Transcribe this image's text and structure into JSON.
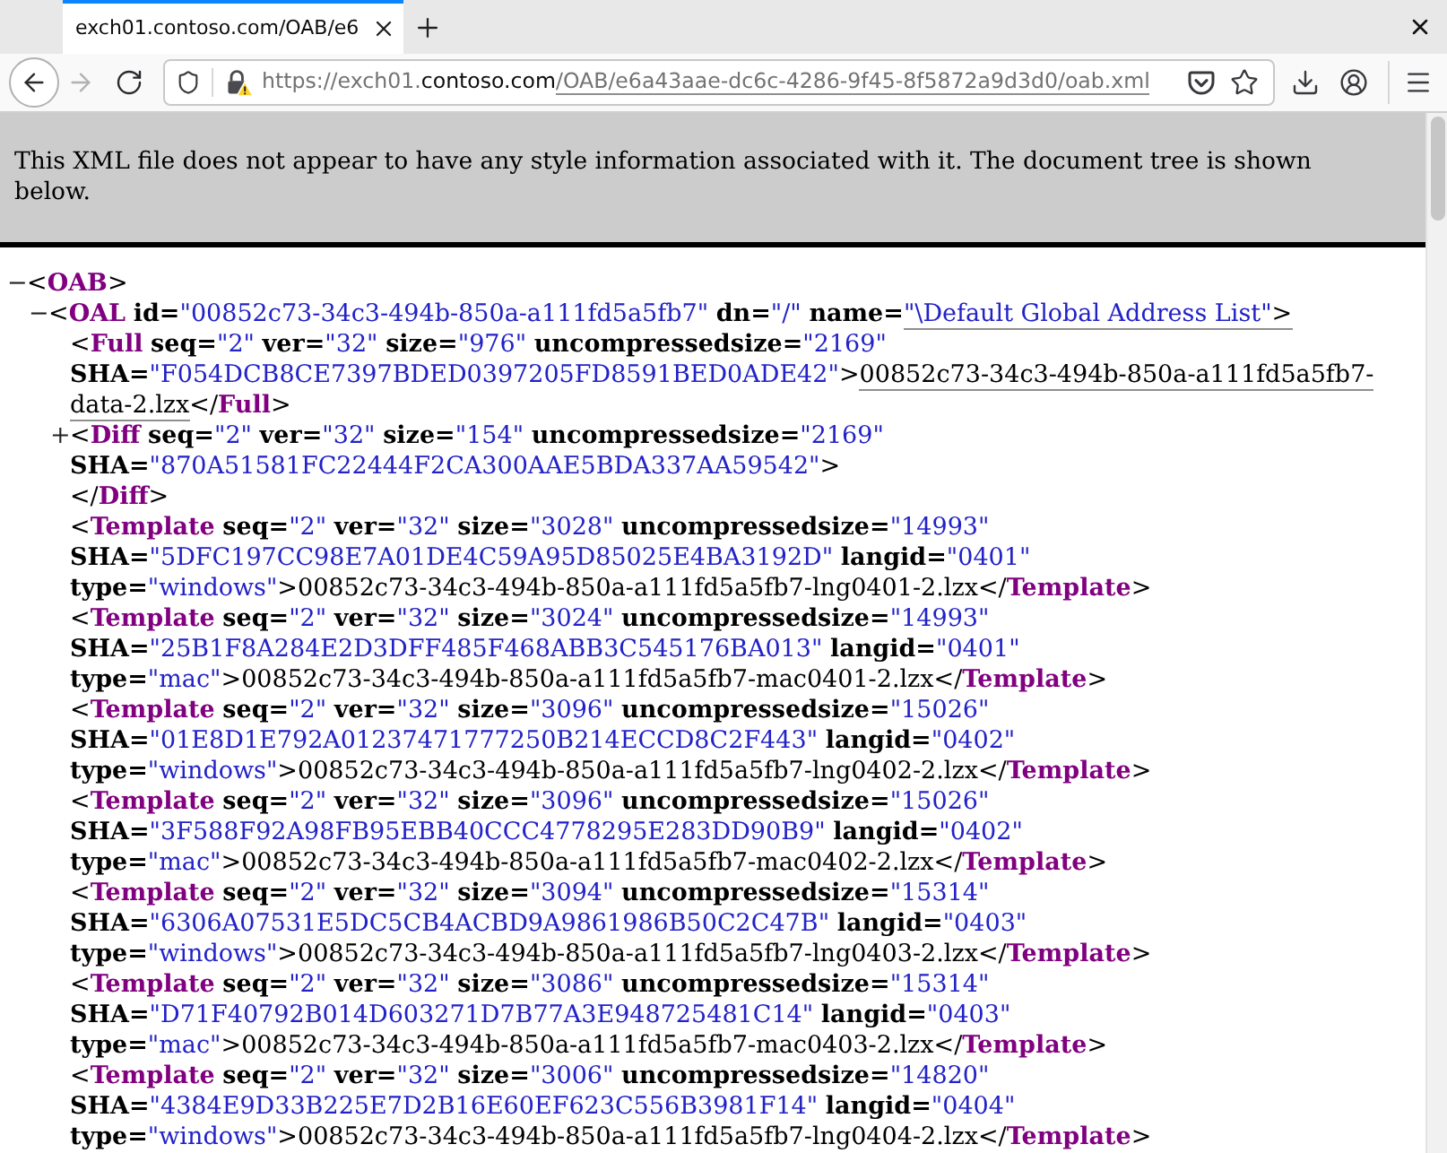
{
  "browser": {
    "tabs": [
      {
        "title": "exch01.contoso.com/OAB/e6",
        "selected": true
      }
    ],
    "nav_buttons": [
      {
        "kind": "back",
        "disabled": false
      },
      {
        "kind": "forward",
        "disabled": true
      },
      {
        "kind": "reload",
        "disabled": false
      }
    ],
    "address": {
      "scheme": "https://",
      "subdomain": "exch01.",
      "domain": "contoso.com",
      "path": "/OAB/e6a43aae-dc6c-4286-9f45-8f5872a9d3d0/oab.xml",
      "path_underlined": true
    }
  },
  "notice": "This XML file does not appear to have any style information associated with it. The document tree is shown below.",
  "xml_tree": [
    {
      "kind": "container",
      "toggle": "−",
      "open": "<",
      "tag": "OAB",
      "close": ">",
      "children": [
        {
          "kind": "container",
          "toggle": "−",
          "open": "<",
          "tag": "OAL",
          "attributes": [
            {
              "name": "id=",
              "value": "\"00852c73-34c3-494b-850a-a111fd5a5fb7\""
            },
            {
              "name": "dn=",
              "value": "\"/\""
            },
            {
              "name": "name=",
              "value": "\"\\Default Global Address List\"",
              "underlined": true
            }
          ],
          "close": ">",
          "children": [
            {
              "kind": "leaf",
              "open": "<",
              "tag": "Full",
              "attributes": [
                {
                  "name": "seq=",
                  "value": "\"2\""
                },
                {
                  "name": "ver=",
                  "value": "\"32\""
                },
                {
                  "name": "size=",
                  "value": "\"976\""
                },
                {
                  "name": "uncompressedsize=",
                  "value": "\"2169\""
                },
                {
                  "name": "SHA=",
                  "value": "\"F054DCB8CE7397BDED0397205FD8591BED0ADE42\""
                }
              ],
              "close": ">",
              "text": "00852c73-34c3-494b-850a-a111fd5a5fb7-data-2.lzx",
              "text_underlined": true,
              "end_open": "</",
              "end_tag": "Full",
              "end_close": ">"
            },
            {
              "kind": "container",
              "toggle": "+",
              "open": "<",
              "tag": "Diff",
              "attributes": [
                {
                  "name": "seq=",
                  "value": "\"2\""
                },
                {
                  "name": "ver=",
                  "value": "\"32\""
                },
                {
                  "name": "size=",
                  "value": "\"154\""
                },
                {
                  "name": "uncompressedsize=",
                  "value": "\"2169\""
                },
                {
                  "name": "SHA=",
                  "value": "\"870A51581FC22444F2CA300AAE5BDA337AA59542\""
                }
              ],
              "close": ">",
              "end_open": "</",
              "end_tag": "Diff",
              "end_close": ">"
            },
            {
              "kind": "leaf",
              "open": "<",
              "tag": "Template",
              "attributes": [
                {
                  "name": "seq=",
                  "value": "\"2\""
                },
                {
                  "name": "ver=",
                  "value": "\"32\""
                },
                {
                  "name": "size=",
                  "value": "\"3028\""
                },
                {
                  "name": "uncompressedsize=",
                  "value": "\"14993\""
                },
                {
                  "name": "SHA=",
                  "value": "\"5DFC197CC98E7A01DE4C59A95D85025E4BA3192D\""
                },
                {
                  "name": "langid=",
                  "value": "\"0401\""
                },
                {
                  "name": "type=",
                  "value": "\"windows\""
                }
              ],
              "close": ">",
              "text": "00852c73-34c3-494b-850a-a111fd5a5fb7-lng0401-2.lzx",
              "end_open": "</",
              "end_tag": "Template",
              "end_close": ">"
            },
            {
              "kind": "leaf",
              "open": "<",
              "tag": "Template",
              "attributes": [
                {
                  "name": "seq=",
                  "value": "\"2\""
                },
                {
                  "name": "ver=",
                  "value": "\"32\""
                },
                {
                  "name": "size=",
                  "value": "\"3024\""
                },
                {
                  "name": "uncompressedsize=",
                  "value": "\"14993\""
                },
                {
                  "name": "SHA=",
                  "value": "\"25B1F8A284E2D3DFF485F468ABB3C545176BA013\""
                },
                {
                  "name": "langid=",
                  "value": "\"0401\""
                },
                {
                  "name": "type=",
                  "value": "\"mac\""
                }
              ],
              "close": ">",
              "text": "00852c73-34c3-494b-850a-a111fd5a5fb7-mac0401-2.lzx",
              "end_open": "</",
              "end_tag": "Template",
              "end_close": ">"
            },
            {
              "kind": "leaf",
              "open": "<",
              "tag": "Template",
              "attributes": [
                {
                  "name": "seq=",
                  "value": "\"2\""
                },
                {
                  "name": "ver=",
                  "value": "\"32\""
                },
                {
                  "name": "size=",
                  "value": "\"3096\""
                },
                {
                  "name": "uncompressedsize=",
                  "value": "\"15026\""
                },
                {
                  "name": "SHA=",
                  "value": "\"01E8D1E792A01237471777250B214ECCD8C2F443\""
                },
                {
                  "name": "langid=",
                  "value": "\"0402\""
                },
                {
                  "name": "type=",
                  "value": "\"windows\""
                }
              ],
              "close": ">",
              "text": "00852c73-34c3-494b-850a-a111fd5a5fb7-lng0402-2.lzx",
              "end_open": "</",
              "end_tag": "Template",
              "end_close": ">"
            },
            {
              "kind": "leaf",
              "open": "<",
              "tag": "Template",
              "attributes": [
                {
                  "name": "seq=",
                  "value": "\"2\""
                },
                {
                  "name": "ver=",
                  "value": "\"32\""
                },
                {
                  "name": "size=",
                  "value": "\"3096\""
                },
                {
                  "name": "uncompressedsize=",
                  "value": "\"15026\""
                },
                {
                  "name": "SHA=",
                  "value": "\"3F588F92A98FB95EBB40CCC4778295E283DD90B9\""
                },
                {
                  "name": "langid=",
                  "value": "\"0402\""
                },
                {
                  "name": "type=",
                  "value": "\"mac\""
                }
              ],
              "close": ">",
              "text": "00852c73-34c3-494b-850a-a111fd5a5fb7-mac0402-2.lzx",
              "end_open": "</",
              "end_tag": "Template",
              "end_close": ">"
            },
            {
              "kind": "leaf",
              "open": "<",
              "tag": "Template",
              "attributes": [
                {
                  "name": "seq=",
                  "value": "\"2\""
                },
                {
                  "name": "ver=",
                  "value": "\"32\""
                },
                {
                  "name": "size=",
                  "value": "\"3094\""
                },
                {
                  "name": "uncompressedsize=",
                  "value": "\"15314\""
                },
                {
                  "name": "SHA=",
                  "value": "\"6306A07531E5DC5CB4ACBD9A9861986B50C2C47B\""
                },
                {
                  "name": "langid=",
                  "value": "\"0403\""
                },
                {
                  "name": "type=",
                  "value": "\"windows\""
                }
              ],
              "close": ">",
              "text": "00852c73-34c3-494b-850a-a111fd5a5fb7-lng0403-2.lzx",
              "end_open": "</",
              "end_tag": "Template",
              "end_close": ">"
            },
            {
              "kind": "leaf",
              "open": "<",
              "tag": "Template",
              "attributes": [
                {
                  "name": "seq=",
                  "value": "\"2\""
                },
                {
                  "name": "ver=",
                  "value": "\"32\""
                },
                {
                  "name": "size=",
                  "value": "\"3086\""
                },
                {
                  "name": "uncompressedsize=",
                  "value": "\"15314\""
                },
                {
                  "name": "SHA=",
                  "value": "\"D71F40792B014D603271D7B77A3E948725481C14\""
                },
                {
                  "name": "langid=",
                  "value": "\"0403\""
                },
                {
                  "name": "type=",
                  "value": "\"mac\""
                }
              ],
              "close": ">",
              "text": "00852c73-34c3-494b-850a-a111fd5a5fb7-mac0403-2.lzx",
              "end_open": "</",
              "end_tag": "Template",
              "end_close": ">"
            },
            {
              "kind": "leaf",
              "open": "<",
              "tag": "Template",
              "attributes": [
                {
                  "name": "seq=",
                  "value": "\"2\""
                },
                {
                  "name": "ver=",
                  "value": "\"32\""
                },
                {
                  "name": "size=",
                  "value": "\"3006\""
                },
                {
                  "name": "uncompressedsize=",
                  "value": "\"14820\""
                },
                {
                  "name": "SHA=",
                  "value": "\"4384E9D33B225E7D2B16E60EF623C556B3981F14\""
                },
                {
                  "name": "langid=",
                  "value": "\"0404\""
                },
                {
                  "name": "type=",
                  "value": "\"windows\""
                }
              ],
              "close": ">",
              "text": "00852c73-34c3-494b-850a-a111fd5a5fb7-lng0404-2.lzx",
              "end_open": "</",
              "end_tag": "Template",
              "end_close": ">"
            }
          ]
        }
      ]
    }
  ]
}
